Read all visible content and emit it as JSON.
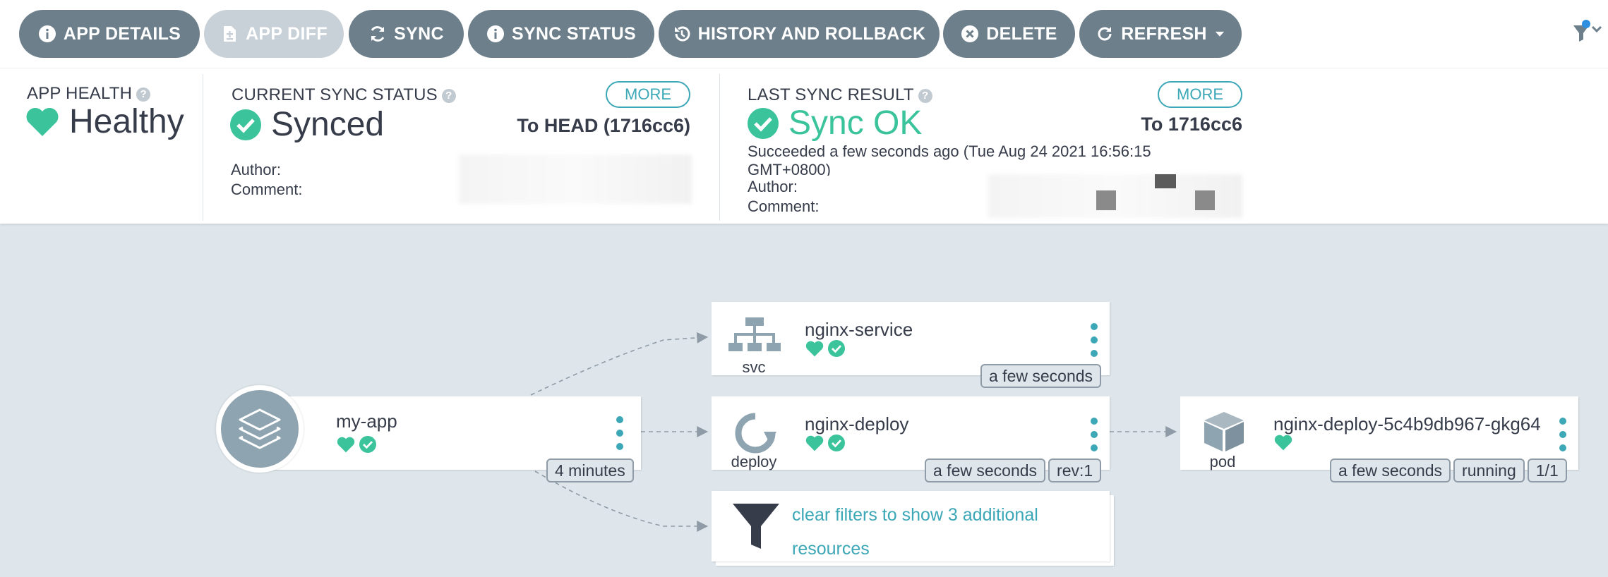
{
  "toolbar": {
    "app_details": "APP DETAILS",
    "app_diff": "APP DIFF",
    "sync": "SYNC",
    "sync_status": "SYNC STATUS",
    "history": "HISTORY AND ROLLBACK",
    "delete": "DELETE",
    "refresh": "REFRESH"
  },
  "health": {
    "title": "APP HEALTH",
    "value": "Healthy"
  },
  "current_sync": {
    "title": "CURRENT SYNC STATUS",
    "value": "Synced",
    "more": "MORE",
    "revision": "To HEAD (1716cc6)",
    "author_label": "Author:",
    "comment_label": "Comment:"
  },
  "last_sync": {
    "title": "LAST SYNC RESULT",
    "value": "Sync OK",
    "more": "MORE",
    "revision": "To 1716cc6",
    "succeeded": "Succeeded a few seconds ago (Tue Aug 24 2021 16:56:15",
    "succeeded_tz": "GMT+0800)",
    "author_label": "Author:",
    "comment_label": "Comment:"
  },
  "graph": {
    "app": {
      "name": "my-app",
      "age": "4 minutes"
    },
    "service": {
      "name": "nginx-service",
      "kind": "svc",
      "age": "a few seconds"
    },
    "deploy": {
      "name": "nginx-deploy",
      "kind": "deploy",
      "age": "a few seconds",
      "rev": "rev:1"
    },
    "pod": {
      "name": "nginx-deploy-5c4b9db967-gkg64",
      "kind": "pod",
      "age": "a few seconds",
      "state": "running",
      "ready": "1/1"
    },
    "filter": {
      "line1": "clear filters to show 3 additional",
      "line2": "resources"
    }
  },
  "colors": {
    "healthy": "#3bc49b",
    "accent": "#3ca7b6",
    "button": "#6d7f8b",
    "button_disabled": "#c9d1d8",
    "background": "#dee6eb"
  }
}
